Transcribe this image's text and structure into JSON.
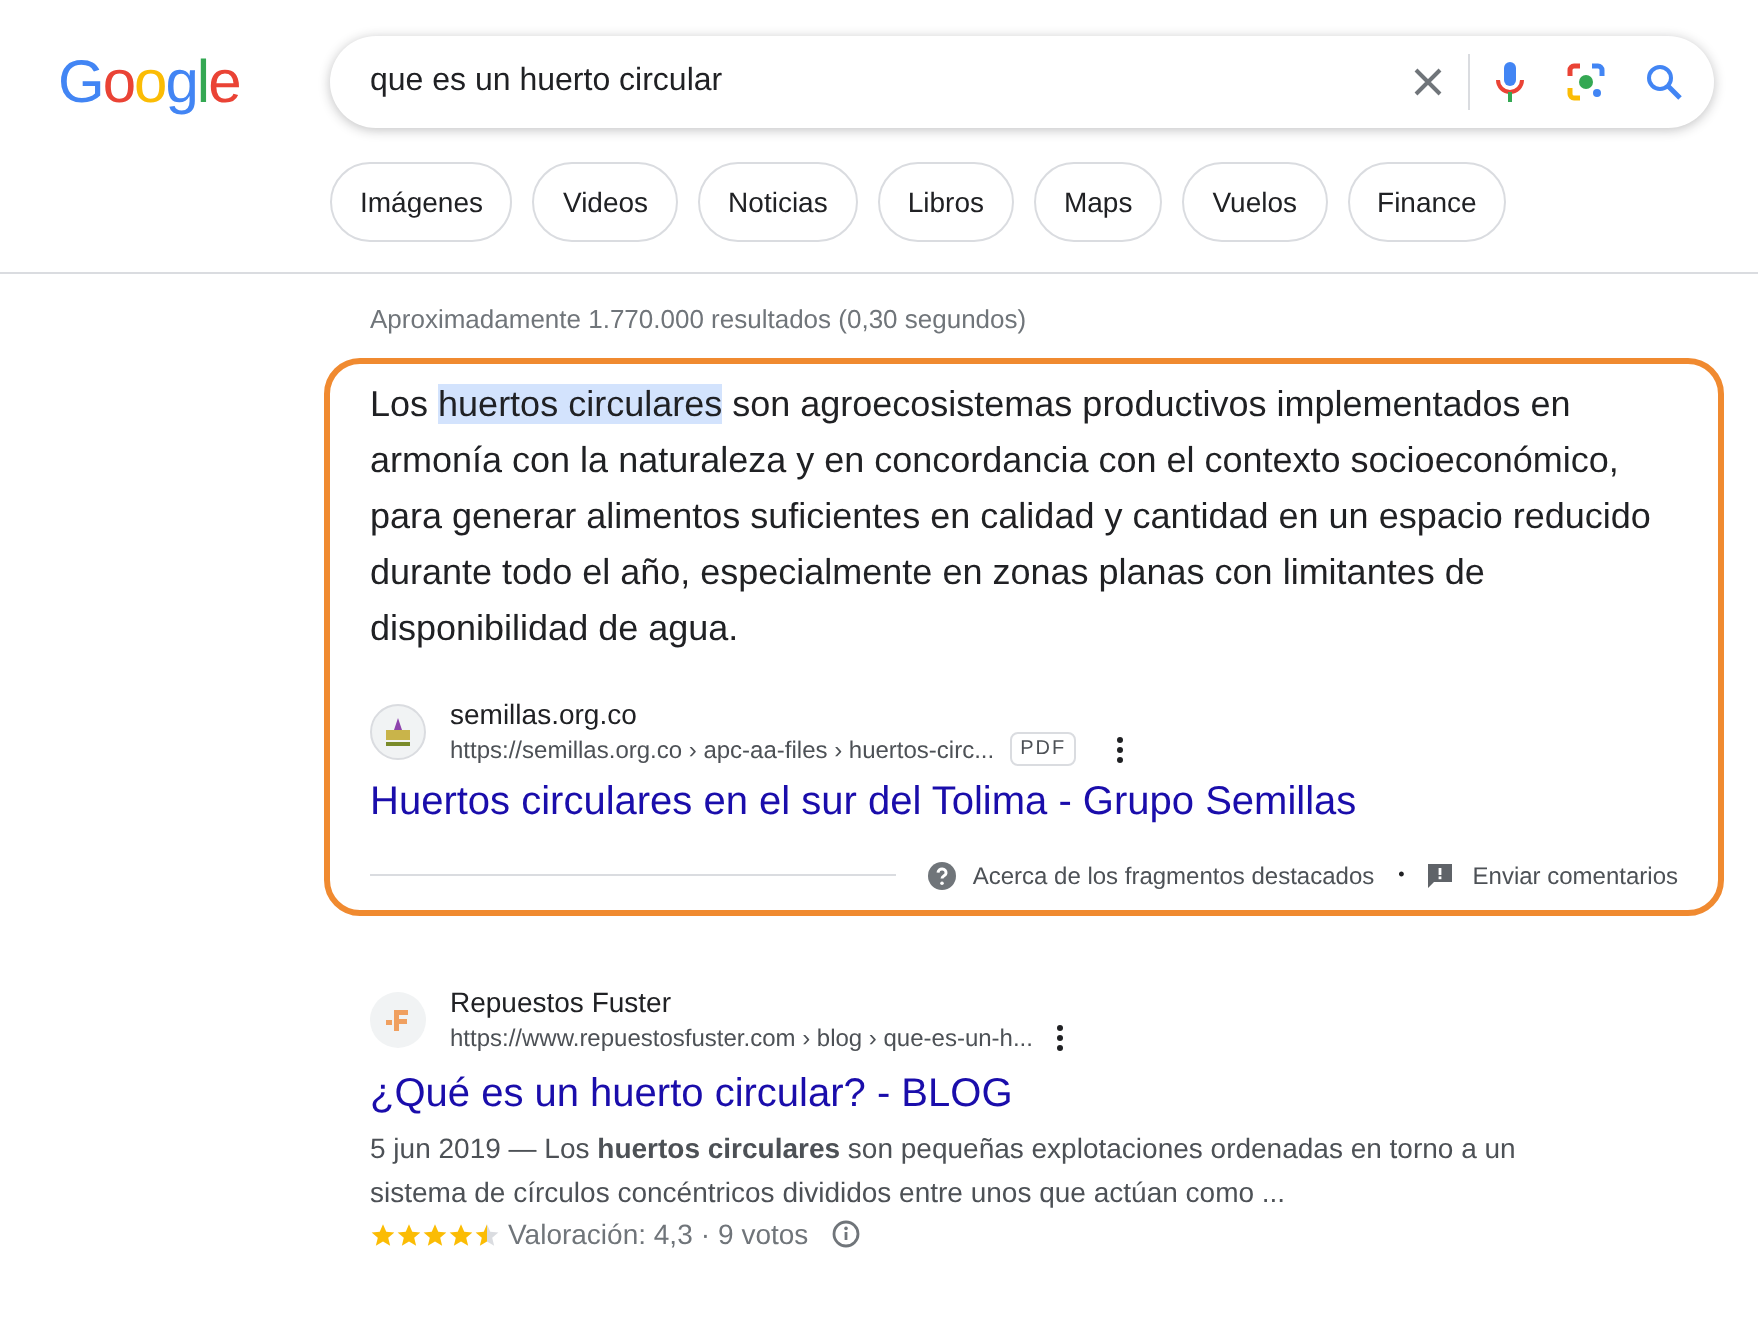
{
  "logo": "Google",
  "search": {
    "value": "que es un huerto circular"
  },
  "chips": [
    {
      "label": "Imágenes",
      "selected": false
    },
    {
      "label": "Videos",
      "selected": false
    },
    {
      "label": "Noticias",
      "selected": false
    },
    {
      "label": "Libros",
      "selected": false
    },
    {
      "label": "Maps",
      "selected": false
    },
    {
      "label": "Vuelos",
      "selected": false
    },
    {
      "label": "Finance",
      "selected": false
    }
  ],
  "result_stats": "Aproximadamente 1.770.000 resultados (0,30 segundos)",
  "featured_snippet": {
    "text_before": "Los ",
    "highlight": "huertos circulares",
    "text_after": " son agroecosistemas productivos implementados en armonía con la naturaleza y en concordancia con el contexto socioeconómico, para generar alimentos suficientes en calidad y cantidad en un espacio reducido durante todo el año, especialmente en zonas planas con limitantes de disponibilidad de agua.",
    "site": "semillas.org.co",
    "url": "https://semillas.org.co › apc-aa-files › huertos-circ...",
    "file_type": "PDF",
    "title": "Huertos circulares en el sur del Tolima - Grupo Semillas",
    "about": "Acerca de los fragmentos destacados",
    "separator": "•",
    "feedback": "Enviar comentarios"
  },
  "result": {
    "site": "Repuestos Fuster",
    "url": "https://www.repuestosfuster.com › blog › que-es-un-h...",
    "title": "¿Qué es un huerto circular? - BLOG",
    "snippet": "5 jun 2019 — Los **huertos circulares** son pequeñas explotaciones ordenadas en torno a un sistema de círculos concéntricos divididos entre unos que actúan como ...",
    "stars": 4.5,
    "rating": "Valoración: 4,3",
    "separator": "·",
    "votes": "9 votos"
  }
}
